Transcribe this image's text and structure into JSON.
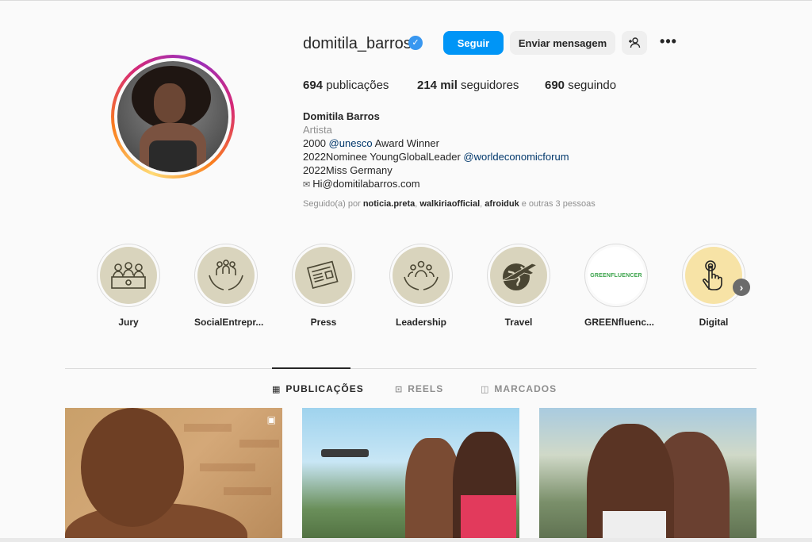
{
  "profile": {
    "username": "domitila_barros",
    "follow_label": "Seguir",
    "message_label": "Enviar mensagem",
    "more_label": "•••",
    "stats": {
      "posts_count": "694",
      "posts_label": " publicações",
      "followers_count": "214 mil",
      "followers_label": " seguidores",
      "following_count": "690",
      "following_label": " seguindo"
    },
    "bio": {
      "name": "Domitila Barros",
      "category": "Artista",
      "line1_a": "2000 ",
      "line1_mention": "@unesco",
      "line1_b": " Award Winner",
      "line2_a": "2022Nominee YoungGlobalLeader ",
      "line2_mention": "@worldeconomicforum",
      "line3": "2022Miss Germany",
      "line4": "Hi@domitilabarros.com"
    },
    "followed_by": {
      "prefix": "Seguido(a) por ",
      "user1": "noticia.preta",
      "sep1": ", ",
      "user2": "walkiriaofficial",
      "sep2": ", ",
      "user3": "afroiduk",
      "suffix": " e outras 3 pessoas"
    }
  },
  "highlights": [
    {
      "label": "Jury",
      "icon": "jury-icon"
    },
    {
      "label": "SocialEntrepr...",
      "icon": "hands-people-icon"
    },
    {
      "label": "Press",
      "icon": "newspaper-icon"
    },
    {
      "label": "Leadership",
      "icon": "leadership-icon"
    },
    {
      "label": "Travel",
      "icon": "globe-plane-icon"
    },
    {
      "label": "GREENfluenc...",
      "icon": "greenfluencer-logo",
      "logo_text": "GREENFLUENCER"
    },
    {
      "label": "Digital",
      "icon": "touch-hand-icon"
    }
  ],
  "tabs": [
    {
      "label": "PUBLICAÇÕES",
      "icon": "grid-icon",
      "active": true
    },
    {
      "label": "REELS",
      "icon": "reels-icon",
      "active": false
    },
    {
      "label": "MARCADOS",
      "icon": "tagged-icon",
      "active": false
    }
  ],
  "colors": {
    "accent": "#0095f6",
    "verified": "#3897f0",
    "link": "#00376b",
    "highlight_bg": "#d9d4bd"
  }
}
